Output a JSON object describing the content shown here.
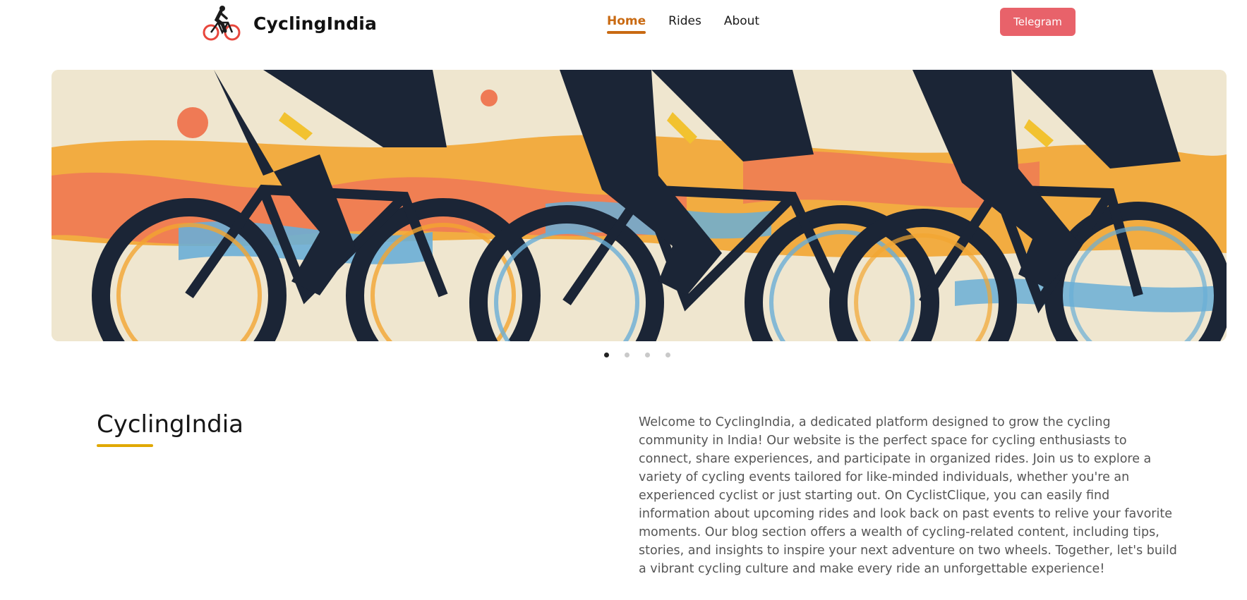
{
  "brand": {
    "name": "CyclingIndia"
  },
  "nav": {
    "items": [
      {
        "label": "Home",
        "active": true
      },
      {
        "label": "Rides",
        "active": false
      },
      {
        "label": "About",
        "active": false
      }
    ]
  },
  "header": {
    "telegram_label": "Telegram"
  },
  "hero": {
    "slide_count": 4,
    "active_slide": 1
  },
  "about": {
    "title": "CyclingIndia",
    "text": "Welcome to CyclingIndia, a dedicated platform designed to grow the cycling community in India! Our website is the perfect space for cycling enthusiasts to connect, share experiences, and participate in organized rides. Join us to explore a variety of cycling events tailored for like-minded individuals, whether you're an experienced cyclist or just starting out. On CyclistClique, you can easily find information about upcoming rides and look back on past events to relive your favorite moments. Our blog section offers a wealth of cycling-related content, including tips, stories, and insights to inspire your next adventure on two wheels. Together, let's build a vibrant cycling culture and make every ride an unforgettable experience!"
  },
  "colors": {
    "accent": "#c96a12",
    "telegram": "#e8626a",
    "underline": "#e0a800",
    "hero_orange": "#f2a531",
    "hero_coral": "#ef7a55",
    "hero_blue": "#6aaed6",
    "hero_navy": "#1b2536"
  }
}
